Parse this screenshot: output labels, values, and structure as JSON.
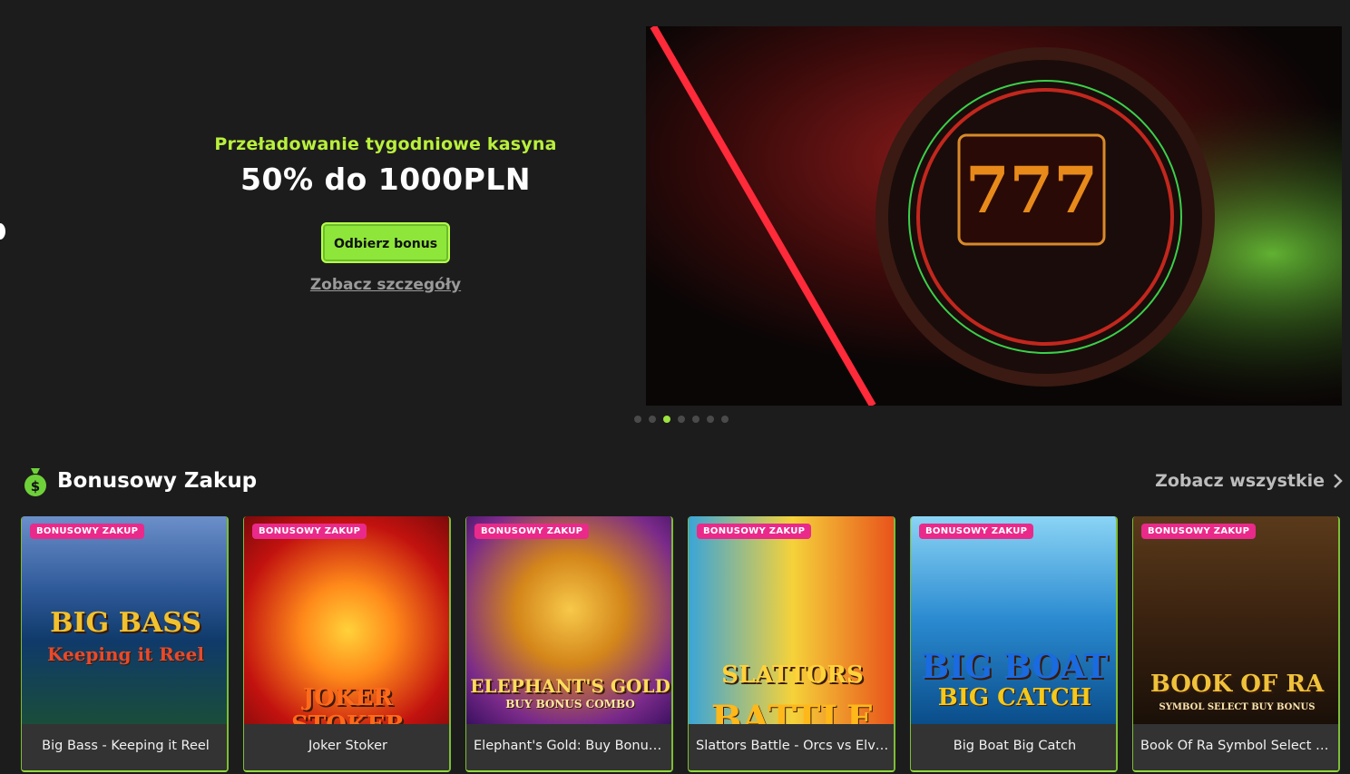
{
  "hero": {
    "subtitle": "Przeładowanie tygodniowe kasyna",
    "title": "50% do 1000PLN",
    "cta_label": "Odbierz bonus",
    "details_link": "Zobacz szczegóły",
    "slides_total": 7,
    "active_slide": 3
  },
  "section": {
    "icon": "money-bag-icon",
    "title": "Bonusowy Zakup",
    "see_all": "Zobacz wszystkie"
  },
  "games": [
    {
      "badge": "BONUSOWY ZAKUP",
      "name": "Big Bass - Keeping it Reel",
      "logo1": "BIG BASS",
      "logo2": "Keeping it Reel"
    },
    {
      "badge": "BONUSOWY ZAKUP",
      "name": "Joker Stoker",
      "logo1": "JOKER STOKER",
      "logo2": ""
    },
    {
      "badge": "BONUSOWY ZAKUP",
      "name": "Elephant's Gold: Buy Bonus ...",
      "logo1": "ELEPHANT'S GOLD",
      "logo2": "BUY BONUS COMBO"
    },
    {
      "badge": "BONUSOWY ZAKUP",
      "name": "Slattors Battle - Orcs vs Elves",
      "logo1": "SLATTORS",
      "logo2": "BATTLE"
    },
    {
      "badge": "BONUSOWY ZAKUP",
      "name": "Big Boat Big Catch",
      "logo1": "BIG BOAT",
      "logo2": "BIG CATCH"
    },
    {
      "badge": "BONUSOWY ZAKUP",
      "name": "Book Of Ra Symbol Select B...",
      "logo1": "BOOK OF RA",
      "logo2": "SYMBOL SELECT BUY BONUS"
    }
  ],
  "colors": {
    "accent": "#9ee33f",
    "badge": "#ea2a8a",
    "background": "#1c1c1c"
  }
}
